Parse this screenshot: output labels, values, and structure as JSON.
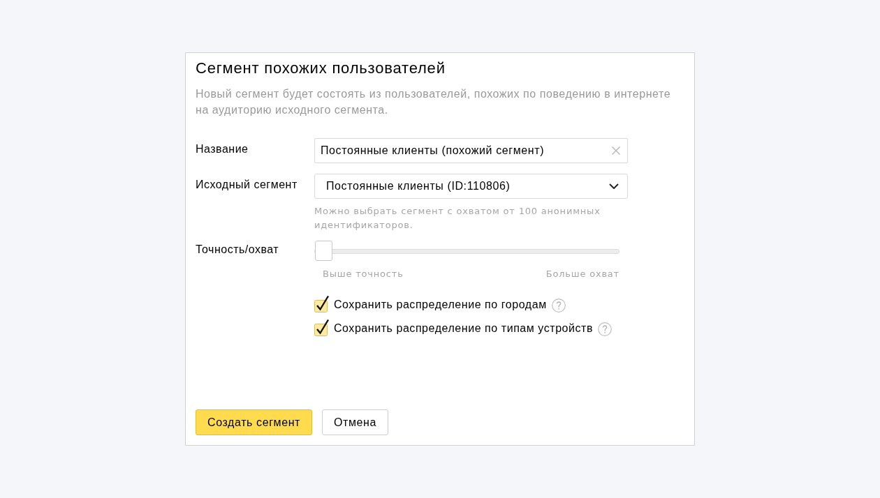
{
  "dialog": {
    "title": "Сегмент похожих пользователей",
    "description": "Новый сегмент будет состоять из пользователей, похожих по поведению в интернете на аудиторию исходного сегмента."
  },
  "fields": [
    {
      "kind": "text",
      "label": "Название",
      "value": "Постоянные клиенты (похожий сегмент)"
    },
    {
      "kind": "select",
      "label": "Исходный сегмент",
      "value": "Постоянные клиенты (ID:110806)",
      "hint": "Можно выбрать сегмент с охватом от 100 анонимных идентификаторов."
    },
    {
      "kind": "slider",
      "label": "Точность/охват",
      "level": 0,
      "min_label": "Выше точность",
      "max_label": "Больше охват"
    }
  ],
  "options": [
    {
      "label": "Сохранить распределение по городам",
      "checked": true
    },
    {
      "label": "Сохранить распределение по типам устройств",
      "checked": true
    }
  ],
  "buttons": [
    {
      "label": "Создать сегмент",
      "kind": "primary"
    },
    {
      "label": "Отмена",
      "kind": "secondary"
    }
  ]
}
